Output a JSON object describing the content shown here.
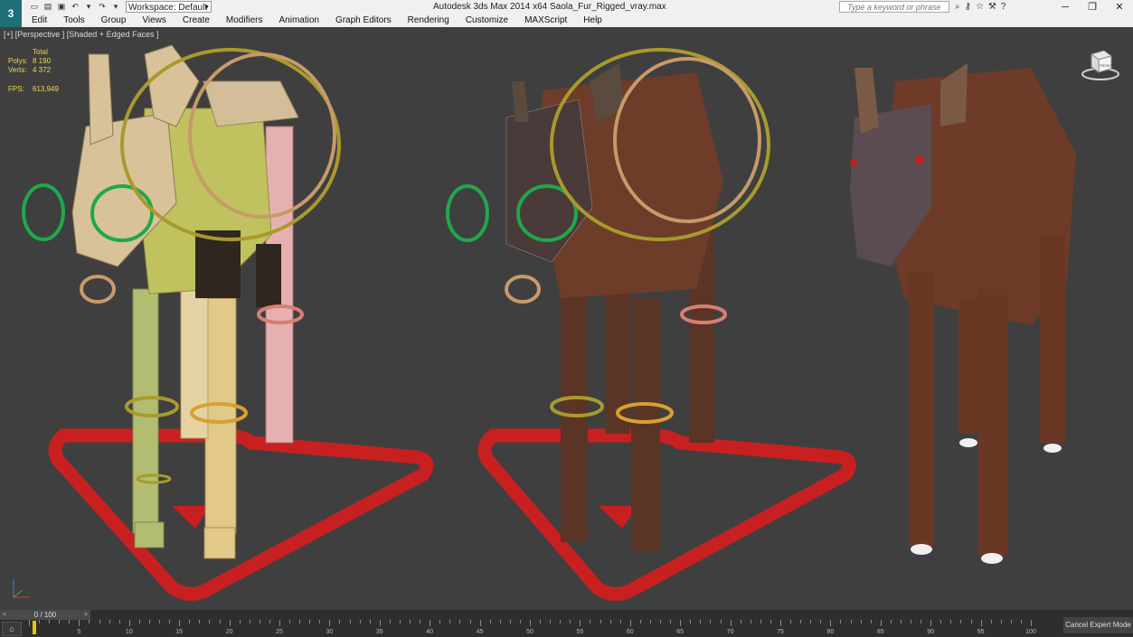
{
  "app": {
    "title": "Autodesk 3ds Max  2014 x64    Saola_Fur_Rigged_vray.max",
    "logo": "3ds-max-logo",
    "workspace_label": "Workspace: Default",
    "search_placeholder": "Type a keyword or phrase",
    "window_controls": [
      "minimize",
      "restore",
      "close"
    ]
  },
  "menu": [
    "Edit",
    "Tools",
    "Group",
    "Views",
    "Create",
    "Modifiers",
    "Animation",
    "Graph Editors",
    "Rendering",
    "Customize",
    "MAXScript",
    "Help"
  ],
  "viewport": {
    "label": "[+] [Perspective ] [Shaded + Edged Faces ]",
    "stats": {
      "header": "Total",
      "rows": [
        {
          "key": "Polys:",
          "value": "8 190"
        },
        {
          "key": "Verts:",
          "value": "4 372"
        },
        {
          "key": "FPS:",
          "value": "613,949"
        }
      ]
    },
    "viewcube_label": "FRONT",
    "models": [
      {
        "name": "proxy-rig-model",
        "style": "shaded-boxes"
      },
      {
        "name": "wireframe-fur-model",
        "style": "edged-faces"
      },
      {
        "name": "rendered-saola-model",
        "style": "fur-shaded"
      }
    ]
  },
  "timeline": {
    "frame_label": "0 / 100",
    "ticks": [
      0,
      5,
      10,
      15,
      20,
      25,
      30,
      35,
      40,
      45,
      50,
      55,
      60,
      65,
      70,
      75,
      80,
      85,
      90,
      95,
      100
    ],
    "cancel_label": "Cancel Expert Mode"
  },
  "colors": {
    "viewport_bg": "#3f3f3f",
    "stats_text": "#f0d84a",
    "control_red": "#c82020",
    "control_green": "#1fa84a",
    "control_gold": "#a89a2c",
    "control_tan": "#c79a6a"
  }
}
